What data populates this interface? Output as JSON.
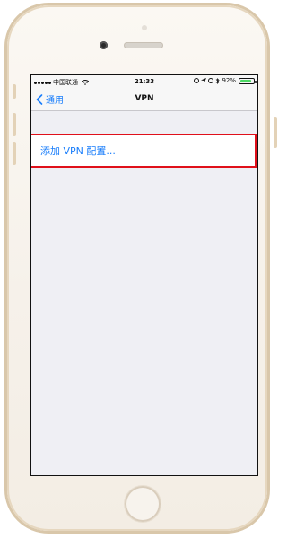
{
  "status_bar": {
    "carrier": "中国联通",
    "time": "21:33",
    "battery_percent": "92%",
    "battery_level": 0.92
  },
  "nav": {
    "back_label": "通用",
    "title": "VPN"
  },
  "vpn": {
    "add_config_label": "添加 VPN 配置..."
  },
  "colors": {
    "accent": "#1a7efb",
    "highlight": "#e0101a",
    "battery": "#4cd964"
  }
}
